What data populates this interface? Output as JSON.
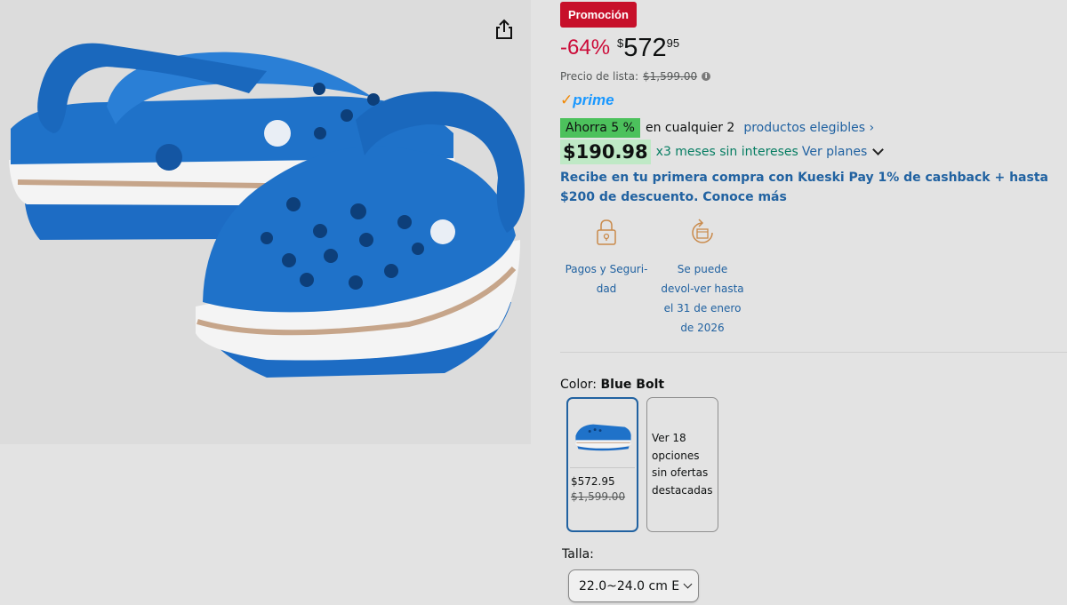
{
  "colors": {
    "promo_badge": "#c7102a",
    "discount": "#cc0c39",
    "link": "#2162a1",
    "prime": "#1a98ff",
    "prime_check": "#f08804",
    "save_badge": "#4cc15c",
    "install_text": "#067d62",
    "shoe_blue": "#1f72c9"
  },
  "product": {
    "share_icon": "share-icon",
    "image_description": "pair-of-blue-clogs"
  },
  "pricing": {
    "promo_badge": "Promoción",
    "discount": "-64%",
    "currency": "$",
    "whole": "572",
    "fraction": "95",
    "list_price_label": "Precio de lista:",
    "list_price": "$1,599.00",
    "info_icon": "i"
  },
  "prime": {
    "check": "✓",
    "label": "prime"
  },
  "savings": {
    "badge": "Ahorra 5 %",
    "text": "en cualquier 2",
    "link": "productos elegibles ›"
  },
  "installments": {
    "price": "$190.98",
    "text": "x3 meses sin intereses",
    "link": "Ver planes"
  },
  "kueski": {
    "text": "Recibe en tu primera compra con Kueski Pay 1% de cashback + hasta $200 de descuento. Conoce más"
  },
  "features": [
    {
      "icon": "lock-icon",
      "label": "Pagos y Seguri-dad"
    },
    {
      "icon": "return-icon",
      "label": "Se puede devol-ver hasta el 31 de enero de 2026"
    }
  ],
  "color_selector": {
    "label": "Color:",
    "value": "Blue Bolt",
    "selected": {
      "price": "$572.95",
      "list_price": "$1,599.00"
    },
    "more": "Ver 18 opciones sin ofertas destacadas"
  },
  "size_selector": {
    "label": "Talla:",
    "value": "22.0~24.0 cm E"
  }
}
